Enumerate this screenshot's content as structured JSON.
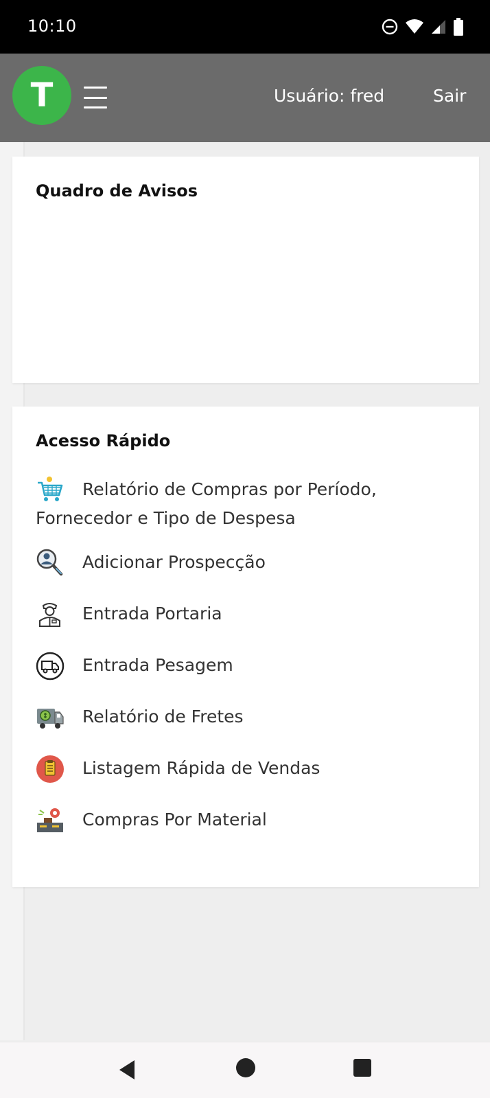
{
  "status_bar": {
    "time": "10:10"
  },
  "header": {
    "logo_letter": "T",
    "user_label": "Usuário: fred",
    "logout_label": "Sair"
  },
  "notices": {
    "title": "Quadro de Avisos"
  },
  "quick_access": {
    "title": "Acesso Rápido",
    "items": [
      {
        "label": "Relatório de Compras por Período, Fornecedor e Tipo de Despesa",
        "icon": "shopping-cart-icon"
      },
      {
        "label": "Adicionar Prospecção",
        "icon": "prospect-search-icon"
      },
      {
        "label": "Entrada Portaria",
        "icon": "gatekeeper-icon"
      },
      {
        "label": "Entrada Pesagem",
        "icon": "truck-weighing-icon"
      },
      {
        "label": "Relatório de Fretes",
        "icon": "freight-truck-icon"
      },
      {
        "label": "Listagem Rápida de Vendas",
        "icon": "sales-clipboard-icon"
      },
      {
        "label": "Compras Por Material",
        "icon": "material-purchase-icon"
      }
    ]
  },
  "colors": {
    "header_bg": "#6b6b6b",
    "logo_green": "#3cb54a",
    "page_bg": "#eeeeee"
  }
}
